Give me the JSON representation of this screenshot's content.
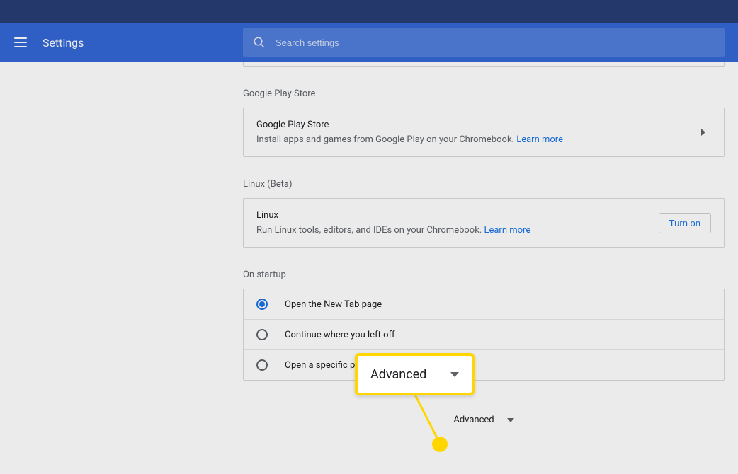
{
  "header": {
    "title": "Settings",
    "search_placeholder": "Search settings"
  },
  "sections": {
    "google_play": {
      "heading": "Google Play Store",
      "title": "Google Play Store",
      "desc": "Install apps and games from Google Play on your Chromebook.",
      "learn_more": "Learn more"
    },
    "linux": {
      "heading": "Linux (Beta)",
      "title": "Linux",
      "desc": "Run Linux tools, editors, and IDEs on your Chromebook.",
      "learn_more": "Learn more",
      "button": "Turn on"
    },
    "startup": {
      "heading": "On startup",
      "options": [
        "Open the New Tab page",
        "Continue where you left off",
        "Open a specific pa"
      ]
    }
  },
  "advanced": {
    "label": "Advanced",
    "callout_label": "Advanced"
  }
}
